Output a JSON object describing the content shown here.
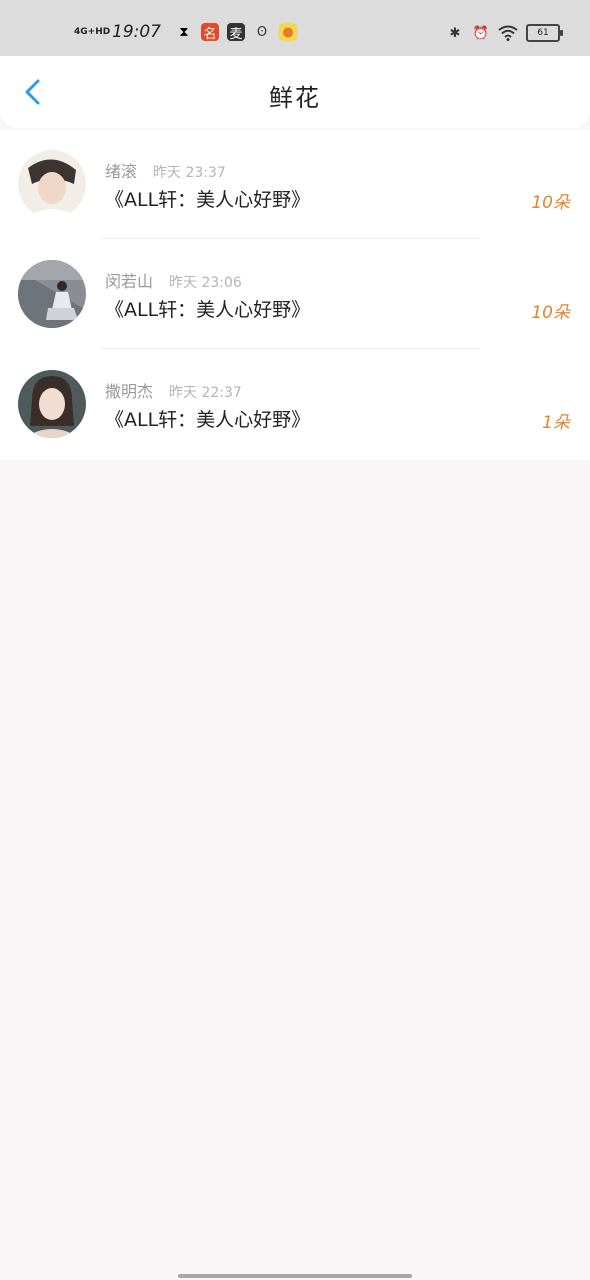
{
  "status_bar": {
    "network": "4G+HD",
    "time": "19:07",
    "battery": "61"
  },
  "header": {
    "title": "鲜花"
  },
  "list": [
    {
      "name": "绪滚",
      "time": "昨天 23:37",
      "book": "《ALL轩：美人心好野》",
      "count": "10朵",
      "avatar_colors": [
        "#f2ede6",
        "#3b3430"
      ]
    },
    {
      "name": "闵若山",
      "time": "昨天 23:06",
      "book": "《ALL轩：美人心好野》",
      "count": "10朵",
      "avatar_colors": [
        "#8a8e94",
        "#cfd3d8"
      ]
    },
    {
      "name": "撒明杰",
      "time": "昨天 22:37",
      "book": "《ALL轩：美人心好野》",
      "count": "1朵",
      "avatar_colors": [
        "#4e5a5c",
        "#e9d6c9"
      ]
    }
  ],
  "colors": {
    "accent": "#2d9be8",
    "count": "#e8822a"
  }
}
